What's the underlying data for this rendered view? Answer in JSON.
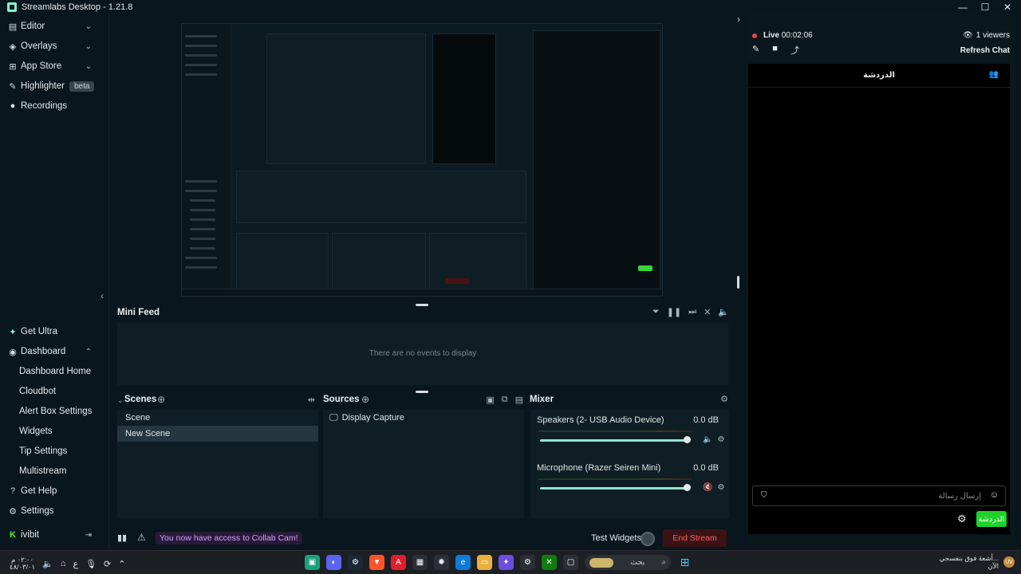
{
  "window": {
    "title": "Streamlabs Desktop - 1.21.8",
    "minimize": "—",
    "maximize": "☐",
    "close": "✕"
  },
  "sidebar": {
    "top_items": [
      {
        "label": "Editor"
      },
      {
        "label": "Overlays"
      },
      {
        "label": "App Store"
      },
      {
        "label": "Highlighter",
        "badge": "beta"
      },
      {
        "label": "Recordings"
      }
    ],
    "bottom_items": [
      {
        "label": "Get Ultra"
      },
      {
        "label": "Dashboard"
      },
      {
        "label": "Dashboard Home"
      },
      {
        "label": "Cloudbot"
      },
      {
        "label": "Alert Box Settings"
      },
      {
        "label": "Widgets"
      },
      {
        "label": "Tip Settings"
      },
      {
        "label": "Multistream"
      },
      {
        "label": "Get Help"
      },
      {
        "label": "Settings"
      },
      {
        "label": "ivibit"
      }
    ]
  },
  "minifeed": {
    "title": "Mini Feed",
    "empty": "There are no events to display"
  },
  "scenes": {
    "title": "Scenes",
    "items": [
      "Scene",
      "New Scene"
    ],
    "active_index": 1
  },
  "sources": {
    "title": "Sources",
    "items": [
      "Display Capture"
    ]
  },
  "mixer": {
    "title": "Mixer",
    "channels": [
      {
        "name": "Speakers (2- USB Audio Device)",
        "level": "0.0 dB",
        "volume_fraction": 0.95
      },
      {
        "name": "Microphone (Razer Seiren Mini)",
        "level": "0.0 dB",
        "volume_fraction": 0.95
      }
    ]
  },
  "footer": {
    "collab_notice": "You now have access to Collab Cam!",
    "test_widgets": "Test Widgets",
    "end_stream": "End Stream"
  },
  "chat": {
    "live_label": "Live",
    "live_time": "00:02:06",
    "viewers": "1 viewers",
    "refresh": "Refresh Chat",
    "header_title": "الدردشة",
    "input_placeholder": "إرسال رسالة",
    "send_label": "الدردشة"
  },
  "taskbar": {
    "time": "٠٢:٠٠ م",
    "date": "٤٨/٠٣/٠١",
    "lang": "ع",
    "search_placeholder": "بحث",
    "notify_line1": "أشعة فوق بنفسجي...",
    "notify_line2": "الآن",
    "avatar": "UV"
  },
  "colors": {
    "accent": "#80f5d2",
    "end_stream_bg": "#3b1315",
    "end_stream_text": "#ff5a62",
    "live_dot": "#f43f43",
    "chat_send": "#1fd22b"
  }
}
